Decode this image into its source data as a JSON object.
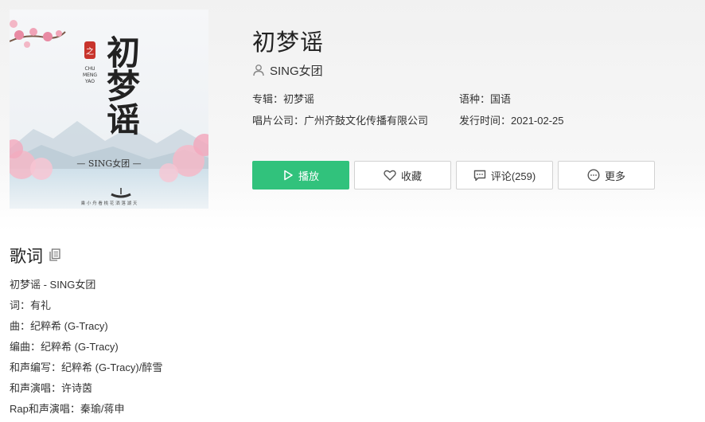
{
  "song": {
    "title": "初梦谣",
    "singer": "SING女团",
    "album_label": "专辑：",
    "album": "初梦谣",
    "language_label": "语种：",
    "language": "国语",
    "company_label": "唱片公司：",
    "company": "广州齐鼓文化传播有限公司",
    "release_label": "发行时间：",
    "release_date": "2021-02-25"
  },
  "cover": {
    "title_vertical": "初梦谣",
    "pinyin_1": "CHU",
    "pinyin_2": "MENG",
    "pinyin_3": "YAO",
    "artist_band": "— SING女团 —",
    "seal_text": "之",
    "footer_text": "乘 小 舟 看 桃 花 洒 落 湖 天"
  },
  "actions": {
    "play_label": "播放",
    "favorite_label": "收藏",
    "comment_label": "评论(259)",
    "more_label": "更多"
  },
  "lyrics": {
    "heading": "歌词",
    "lines": [
      "初梦谣 - SING女团",
      "词：有礼",
      "曲：纪粹希 (G-Tracy)",
      "编曲：纪粹希 (G-Tracy)",
      "和声编写：纪粹希 (G-Tracy)/醉雪",
      "和声演唱：许诗茵",
      "Rap和声演唱：秦瑜/蒋申"
    ]
  },
  "colors": {
    "accent": "#31c27c",
    "border": "#d2d2d2",
    "text": "#333333"
  }
}
